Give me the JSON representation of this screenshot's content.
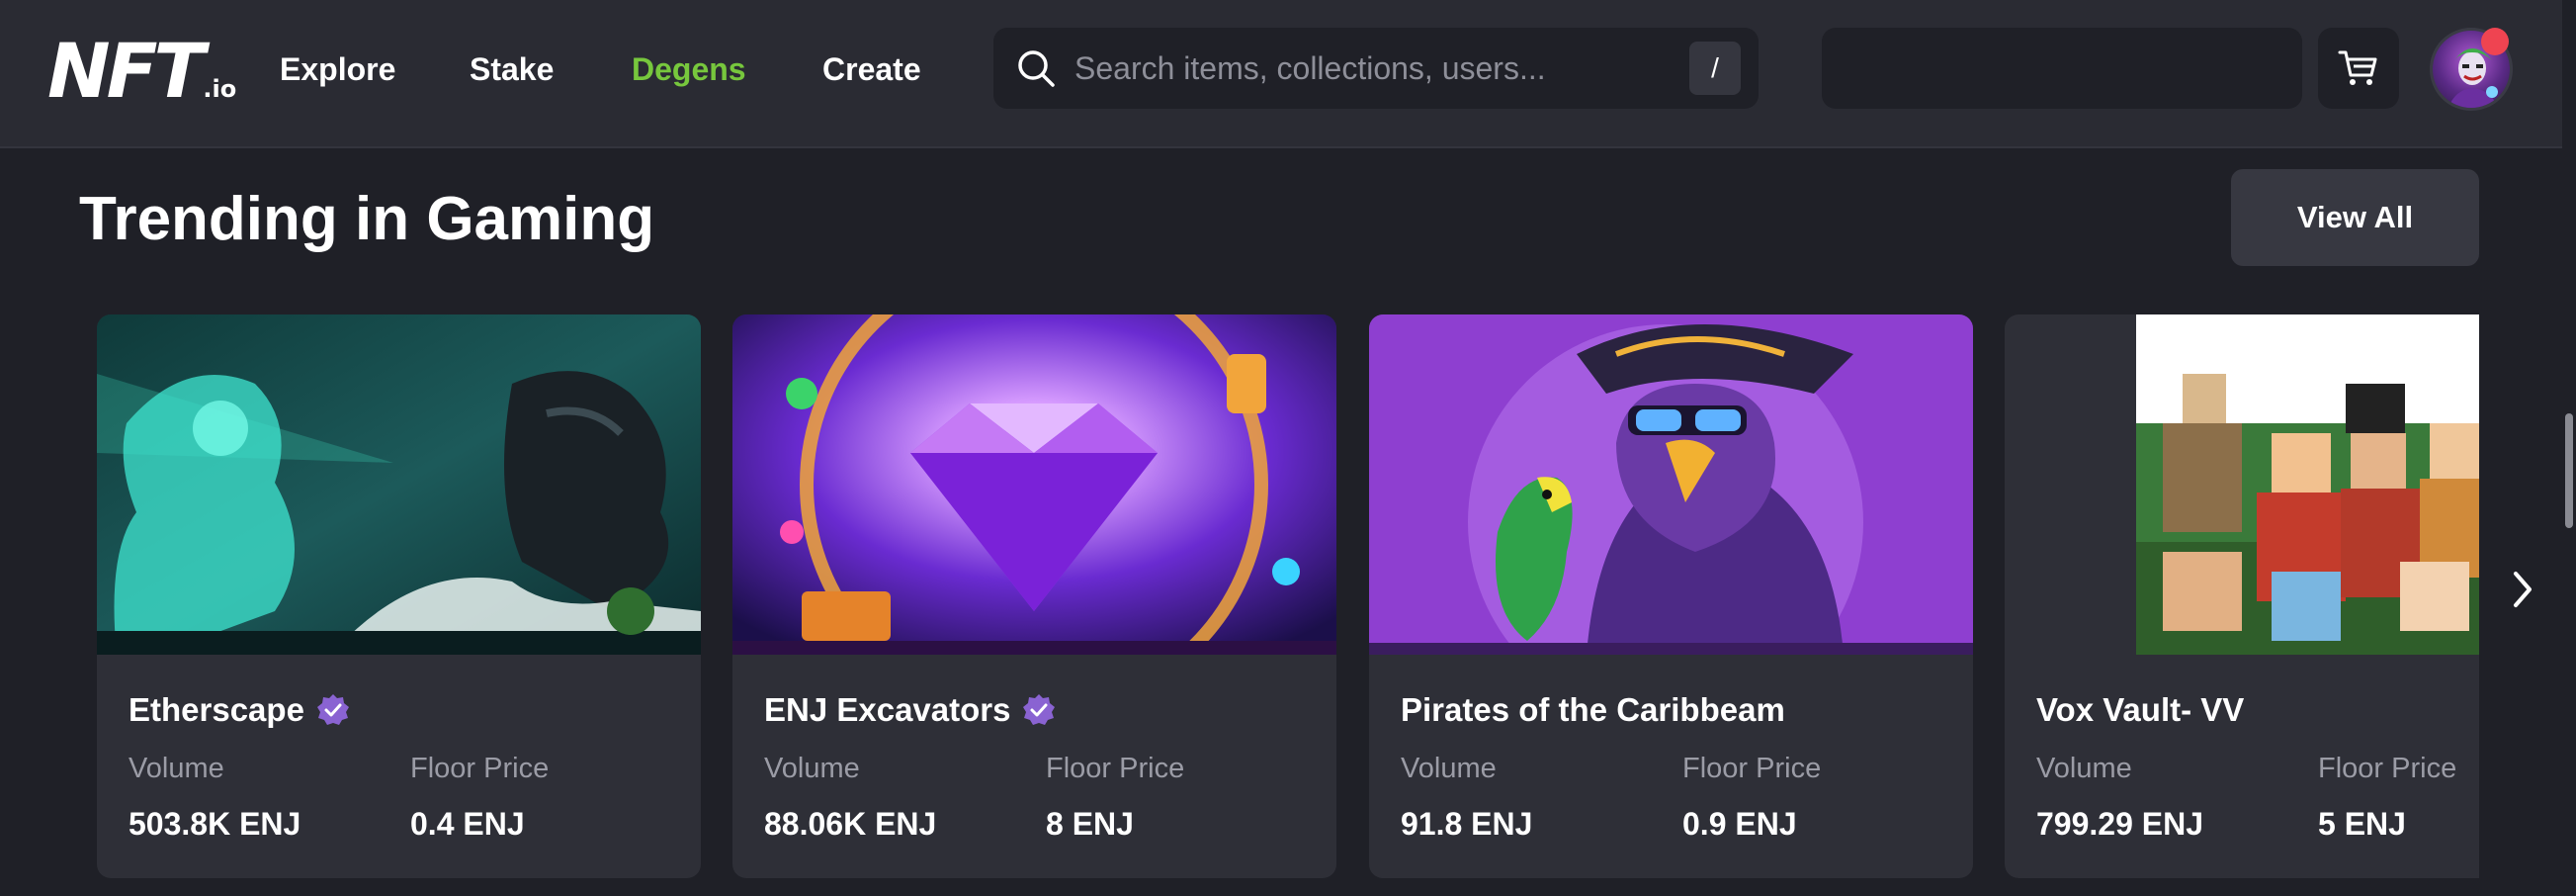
{
  "header": {
    "logo": {
      "mark": "NFT",
      "tld": ".io"
    },
    "nav": [
      {
        "label": "Explore",
        "active": false
      },
      {
        "label": "Stake",
        "active": false
      },
      {
        "label": "Degens",
        "active": true
      },
      {
        "label": "Create",
        "active": false
      }
    ],
    "search": {
      "placeholder": "Search items, collections, users...",
      "shortcut": "/"
    },
    "icons": {
      "search": "search-icon",
      "cart": "cart-icon",
      "avatar": "user-avatar"
    }
  },
  "section": {
    "title": "Trending in Gaming",
    "view_all_label": "View All"
  },
  "cards": [
    {
      "name": "Etherscape",
      "verified": true,
      "volume_label": "Volume",
      "volume": "503.8K ENJ",
      "floor_label": "Floor Price",
      "floor": "0.4 ENJ"
    },
    {
      "name": "ENJ Excavators",
      "verified": true,
      "volume_label": "Volume",
      "volume": "88.06K ENJ",
      "floor_label": "Floor Price",
      "floor": "8 ENJ"
    },
    {
      "name": "Pirates of the Caribbeam",
      "verified": false,
      "volume_label": "Volume",
      "volume": "91.8 ENJ",
      "floor_label": "Floor Price",
      "floor": "0.9 ENJ"
    },
    {
      "name": "Vox Vault- VV",
      "verified": false,
      "volume_label": "Volume",
      "volume": "799.29 ENJ",
      "floor_label": "Floor Price",
      "floor": "5 ENJ"
    }
  ],
  "colors": {
    "background": "#1f2027",
    "topbar": "#2a2b33",
    "card": "#2e2f37",
    "accent_green": "#77c73d",
    "verified_purple": "#8a63d2",
    "notification_red": "#ef4451"
  }
}
